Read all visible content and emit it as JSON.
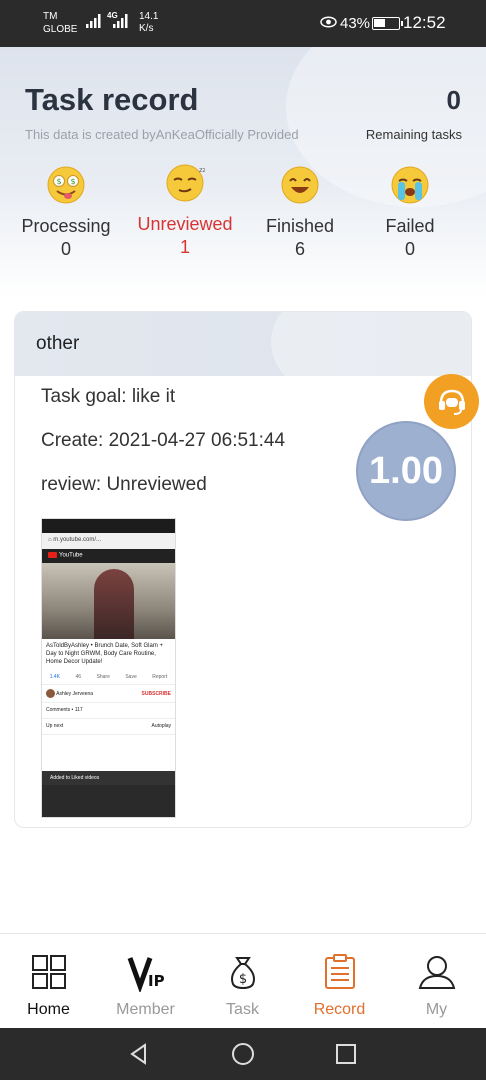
{
  "status_bar": {
    "carrier_line1": "TM",
    "carrier_line2": "GLOBE",
    "network_type": "4G",
    "speed_value": "14.1",
    "speed_unit": "K/s",
    "battery": "43%",
    "time": "12:52"
  },
  "header": {
    "title": "Task record",
    "subtitle": "This data is created byAnKeaOfficially Provided",
    "remaining_count": "0",
    "remaining_label": "Remaining tasks"
  },
  "stats": [
    {
      "label": "Processing",
      "value": "0",
      "icon": "money-eyes-emoji-icon"
    },
    {
      "label": "Unreviewed",
      "value": "1",
      "icon": "sleepy-emoji-icon"
    },
    {
      "label": "Finished",
      "value": "6",
      "icon": "happy-emoji-icon"
    },
    {
      "label": "Failed",
      "value": "0",
      "icon": "crying-emoji-icon"
    }
  ],
  "card": {
    "category": "other",
    "task_goal": "Task goal: like it",
    "create": "Create: 2021-04-27 06:51:44",
    "review": "review: Unreviewed",
    "score": "1.00",
    "thumbnail": {
      "url": "m.youtube.com/...",
      "app": "YouTube",
      "video_title": "AsToldByAshley • Brunch Date, Soft Glam + Day to Night GRWM, Body Care Routine, Home Decor Update!",
      "channel": "Ashley Jerveena",
      "subscribe": "SUBSCRIBE",
      "comments": "Comments • 117",
      "up_next": "Up next",
      "autoplay": "Autoplay",
      "toast": "Added to Liked videos",
      "actions": [
        "1.4K",
        "46",
        "Share",
        "Save",
        "Report"
      ]
    }
  },
  "nav": [
    {
      "label": "Home",
      "icon": "home-grid-icon"
    },
    {
      "label": "Member",
      "icon": "vip-icon"
    },
    {
      "label": "Task",
      "icon": "money-bag-icon"
    },
    {
      "label": "Record",
      "icon": "clipboard-icon"
    },
    {
      "label": "My",
      "icon": "user-icon"
    }
  ],
  "colors": {
    "active_stat": "#d83434",
    "active_nav": "#e0702c",
    "score_circle": "#9eb0d0",
    "support_button": "#f2a024"
  }
}
